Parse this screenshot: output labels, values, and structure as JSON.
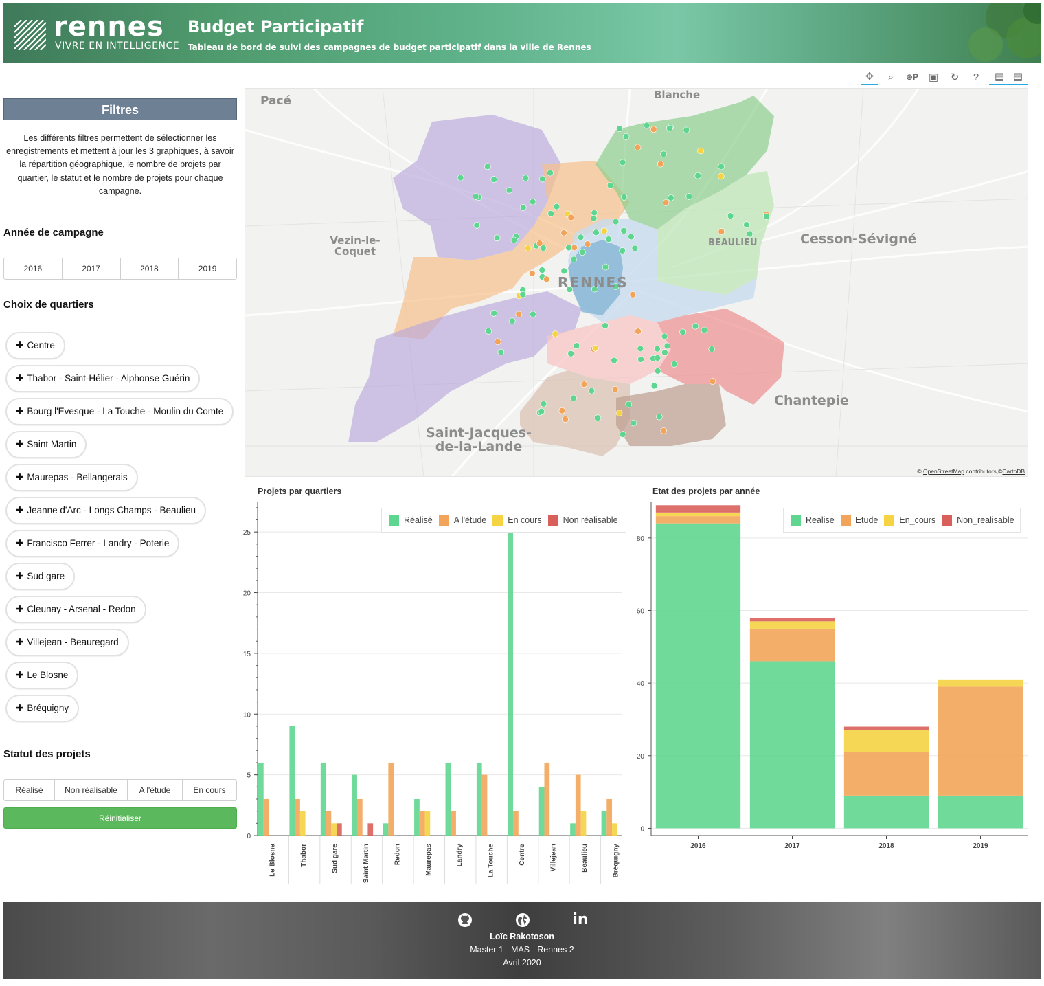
{
  "header": {
    "brand": "rennes",
    "slogan": "VIVRE EN INTELLIGENCE",
    "title": "Budget Participatif",
    "subtitle": "Tableau de bord de suivi des campagnes de budget participatif dans la ville de Rennes"
  },
  "toolbar": {
    "tools": [
      "pan-icon",
      "box-zoom-icon",
      "wheel-zoom-icon",
      "save-icon",
      "reset-icon",
      "help-icon",
      "hover-icon",
      "hover-icon"
    ]
  },
  "sidebar": {
    "filters_title": "Filtres",
    "filters_desc": "Les différents filtres permettent de sélectionner les enregistrements et mettent à jour les 3 graphiques, à savoir la répartition géographique, le nombre de projets par quartier, le statut et le nombre de projets pour chaque campagne.",
    "year_title": "Année de campagne",
    "years": [
      "2016",
      "2017",
      "2018",
      "2019"
    ],
    "district_title": "Choix de quartiers",
    "districts": [
      "Centre",
      "Thabor - Saint-Hélier - Alphonse Guérin",
      "Bourg l'Evesque - La Touche - Moulin du Comte",
      "Saint Martin",
      "Maurepas - Bellangerais",
      "Jeanne d'Arc - Longs Champs - Beaulieu",
      "Francisco Ferrer - Landry - Poterie",
      "Sud gare",
      "Cleunay - Arsenal - Redon",
      "Villejean - Beauregard",
      "Le Blosne",
      "Bréquigny"
    ],
    "status_title": "Statut des projets",
    "statuses": [
      "Réalisé",
      "Non réalisable",
      "A l'étude",
      "En cours"
    ],
    "reset_label": "Réinitialiser"
  },
  "map": {
    "places": [
      "Pacé",
      "Blanche",
      "Vezin-le-Coquet",
      "BEAULIEU",
      "Cesson-Sévigné",
      "RENNES",
      "Chantepie",
      "Saint-Jacques-de-la-Lande"
    ],
    "attribution_prefix": "©",
    "attribution_osm": "OpenStreetMap",
    "attribution_mid": "contributors,©",
    "attribution_carto": "CartoDB"
  },
  "colors": {
    "realise": "#5fd68f",
    "etude": "#f2a55a",
    "en_cours": "#f5d342",
    "non_realisable": "#d9605a"
  },
  "chart_data": [
    {
      "type": "bar",
      "title": "Projets par quartiers",
      "categories": [
        "Le Blosne",
        "Thabor",
        "Sud gare",
        "Saint Martin",
        "Redon",
        "Maurepas",
        "Landry",
        "La Touche",
        "Centre",
        "Villejean",
        "Beaulieu",
        "Bréquigny"
      ],
      "series": [
        {
          "name": "Réalisé",
          "values": [
            6,
            9,
            6,
            5,
            1,
            3,
            6,
            6,
            26,
            4,
            1,
            2
          ]
        },
        {
          "name": "A l'étude",
          "values": [
            3,
            3,
            2,
            3,
            6,
            2,
            2,
            5,
            2,
            6,
            5,
            3
          ]
        },
        {
          "name": "En cours",
          "values": [
            0,
            2,
            1,
            0,
            0,
            2,
            0,
            0,
            0,
            0,
            2,
            1
          ]
        },
        {
          "name": "Non réalisable",
          "values": [
            0,
            0,
            1,
            1,
            0,
            0,
            0,
            0,
            0,
            0,
            0,
            0
          ]
        }
      ],
      "yticks": [
        0,
        5,
        10,
        15,
        20,
        25
      ],
      "ylim": [
        0,
        27.5
      ],
      "legend": "top-right",
      "grid": true
    },
    {
      "type": "bar",
      "stacked": true,
      "title": "Etat des projets par année",
      "categories": [
        "2016",
        "2017",
        "2018",
        "2019"
      ],
      "series": [
        {
          "name": "Realise",
          "values": [
            84,
            46,
            9,
            9
          ]
        },
        {
          "name": "Etude",
          "values": [
            2,
            9,
            12,
            30
          ]
        },
        {
          "name": "En_cours",
          "values": [
            1,
            2,
            6,
            2
          ]
        },
        {
          "name": "Non_realisable",
          "values": [
            2,
            1,
            1,
            0
          ]
        }
      ],
      "yticks": [
        0,
        20,
        40,
        60,
        80
      ],
      "ylim": [
        -2,
        90
      ],
      "legend": "top-right",
      "grid": true
    }
  ],
  "footer": {
    "icons": [
      "github-icon",
      "globe-icon",
      "linkedin-icon"
    ],
    "linkedin_glyph": "in",
    "author": "Loïc Rakotoson",
    "program": "Master 1 - MAS - Rennes 2",
    "date": "Avril 2020"
  }
}
